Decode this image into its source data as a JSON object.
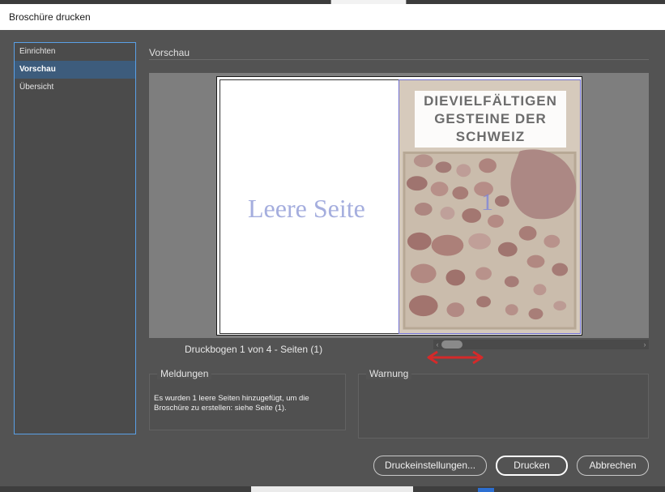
{
  "window": {
    "title": "Broschüre drucken"
  },
  "sidebar": {
    "items": [
      {
        "label": "Einrichten",
        "active": false
      },
      {
        "label": "Vorschau",
        "active": true
      },
      {
        "label": "Übersicht",
        "active": false
      }
    ]
  },
  "section": {
    "title": "Vorschau"
  },
  "preview": {
    "empty_page_label": "Leere Seite",
    "page_number": "1",
    "cover_title_lines": [
      "DIEVIELFÄLTIGEN",
      "GESTEINE DER",
      "SCHWEIZ"
    ],
    "spread_info": "Druckbogen 1 von 4 - Seiten (1)"
  },
  "messages": {
    "label": "Meldungen",
    "text": "Es wurden 1 leere Seiten hinzugefügt, um die Broschüre zu erstellen: siehe Seite (1)."
  },
  "warning": {
    "label": "Warnung",
    "text": ""
  },
  "buttons": {
    "settings": "Druckeinstellungen...",
    "print": "Drucken",
    "cancel": "Abbrechen"
  },
  "icons": {
    "scroll_left": "chevron-left-icon",
    "scroll_right": "chevron-right-icon",
    "annotation_arrow": "double-arrow-icon"
  },
  "colors": {
    "sidebar_focus_border": "#5aa0e6",
    "sidebar_active_bg": "#3d5c7c",
    "annotation_arrow": "#d42a2a",
    "empty_page_text": "#a5aede"
  }
}
